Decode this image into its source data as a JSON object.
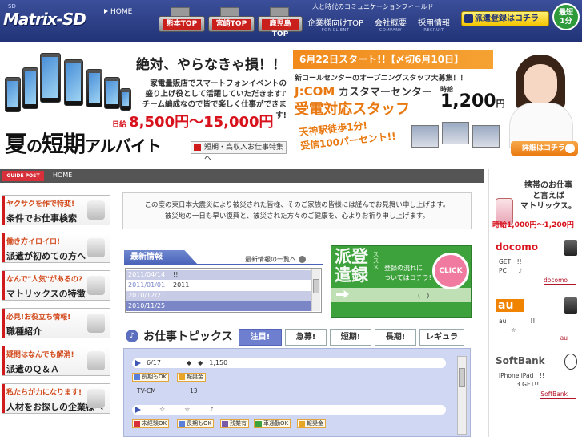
{
  "header": {
    "logo_sub": "SD",
    "logo": "Matrix-SD",
    "home": "HOME",
    "tagline": "人と時代のコミュニケーションフィールド",
    "areas": [
      "熊本TOP",
      "宮崎TOP",
      "鹿児島TOP"
    ],
    "nav": [
      {
        "label": "企業様向けTOP",
        "sub": "FOR CLIENT"
      },
      {
        "label": "会社概要",
        "sub": "COMPANY"
      },
      {
        "label": "採用情報",
        "sub": "RECRUIT"
      }
    ],
    "register": "派遣登録はコチラ",
    "badge_top": "最短",
    "badge_bottom": "1分"
  },
  "banner_left": {
    "headline": "絶対、やらなきゃ損！！",
    "lines": [
      "家電量販店でスマートフォンイベントの",
      "盛り上げ役として活躍していただきます♪",
      "チーム編成なので皆で楽しく仕事ができます!"
    ],
    "wage_prefix": "日給",
    "wage": "8,500円～15,000円",
    "summer_1": "夏",
    "summer_2": "の",
    "summer_3": "短期",
    "summer_4": "アルバイト",
    "link": "短期・高収入お仕事特集へ"
  },
  "banner_right": {
    "date": "6月22日スタート!!【〆切6月10日】",
    "sub": "新コールセンターのオープニングスタッフ大募集！！",
    "jcom": "J:COM",
    "jcom_rest": "カスタマーセンター",
    "staff": "受電対応スタッフ",
    "hourly": "時給",
    "wage": "1,200",
    "yen": "円",
    "tenjin_1": "天神駅徒歩1分!",
    "tenjin_2": "受信100パーセント!!",
    "detail": "詳細はコチラ"
  },
  "guide": {
    "post": "GUIDE POST",
    "home": "HOME"
  },
  "sidebar": [
    {
      "top": "ヤクサクを作で特変!",
      "label": "条件でお仕事検索"
    },
    {
      "top": "働き方イロイロ!",
      "label": "派遣が初めての方へ"
    },
    {
      "top": "なんで\"人気\"があるの?",
      "label": "マトリックスの特徴"
    },
    {
      "top": "必見!お役立ち情報!",
      "label": "職種紹介"
    },
    {
      "top": "疑問はなんでも解消!",
      "label": "派遣のＱ＆Ａ"
    },
    {
      "top": "私たちが力になります!",
      "label": "人材をお探しの企業様へ"
    }
  ],
  "notice": {
    "line1": "この度の東日本大震災により被災された皆様、そのご家族の皆様には謹んでお見舞い申し上げます。",
    "line2": "被災地の一日も早い復興と、被災された方々のご健康を、心よりお祈り申し上げます。"
  },
  "news": {
    "heading": "最新情報",
    "list_link": "最新情報の一覧へ",
    "items": [
      {
        "date": "2011/04/14",
        "text": "!!"
      },
      {
        "date": "2011/01/01",
        "text": "2011"
      },
      {
        "date": "2010/12/21",
        "text": ""
      },
      {
        "date": "2010/11/25",
        "text": ""
      }
    ]
  },
  "haken": {
    "big_1": "派登",
    "big_2": "遣録",
    "side": "ススメ",
    "msg_1": "登録の流れに",
    "msg_2": "ついてはコチラ!",
    "paren": "(　)",
    "click": "CLICK"
  },
  "topics": {
    "heading": "お仕事トピックス",
    "bullet": "♪",
    "tabs": [
      "注目!",
      "急募!",
      "短期!",
      "長期!",
      "レギュラー!"
    ],
    "items": [
      {
        "text": "6/17　　　　◆　◆　1,150",
        "tags": [
          "長期もOK",
          "報奨金"
        ],
        "desc_1": "TV-CM",
        "desc_2": "13"
      },
      {
        "text": "　　☆　　　☆　　　♪",
        "tags": [
          "未経験OK",
          "長期もOK",
          "残業有",
          "車通勤OK",
          "報奨金"
        ]
      }
    ]
  },
  "right_column": {
    "mobile_1": "携帯のお仕事",
    "mobile_2": "と言えば",
    "mobile_3": "マトリックス。",
    "mobile_wage": "時給1,000円～1,200円",
    "carriers": [
      {
        "name": "docomo",
        "color": "#d8121c",
        "l1": "GET　!!",
        "l2": "PC　　♪",
        "link": "docomo"
      },
      {
        "name": "au",
        "color": "#f08300",
        "l1": "au　　　　!!",
        "l2": "　　☆",
        "link": "au"
      },
      {
        "name": "SoftBank",
        "color": "#555555",
        "l1": "iPhone iPad　!!",
        "l2": "3 GET!!",
        "link": "SoftBank"
      }
    ]
  },
  "colors": {
    "header": "#2d3f85",
    "accent_red": "#d8121c",
    "orange": "#e8780f",
    "green": "#3ea23c"
  }
}
